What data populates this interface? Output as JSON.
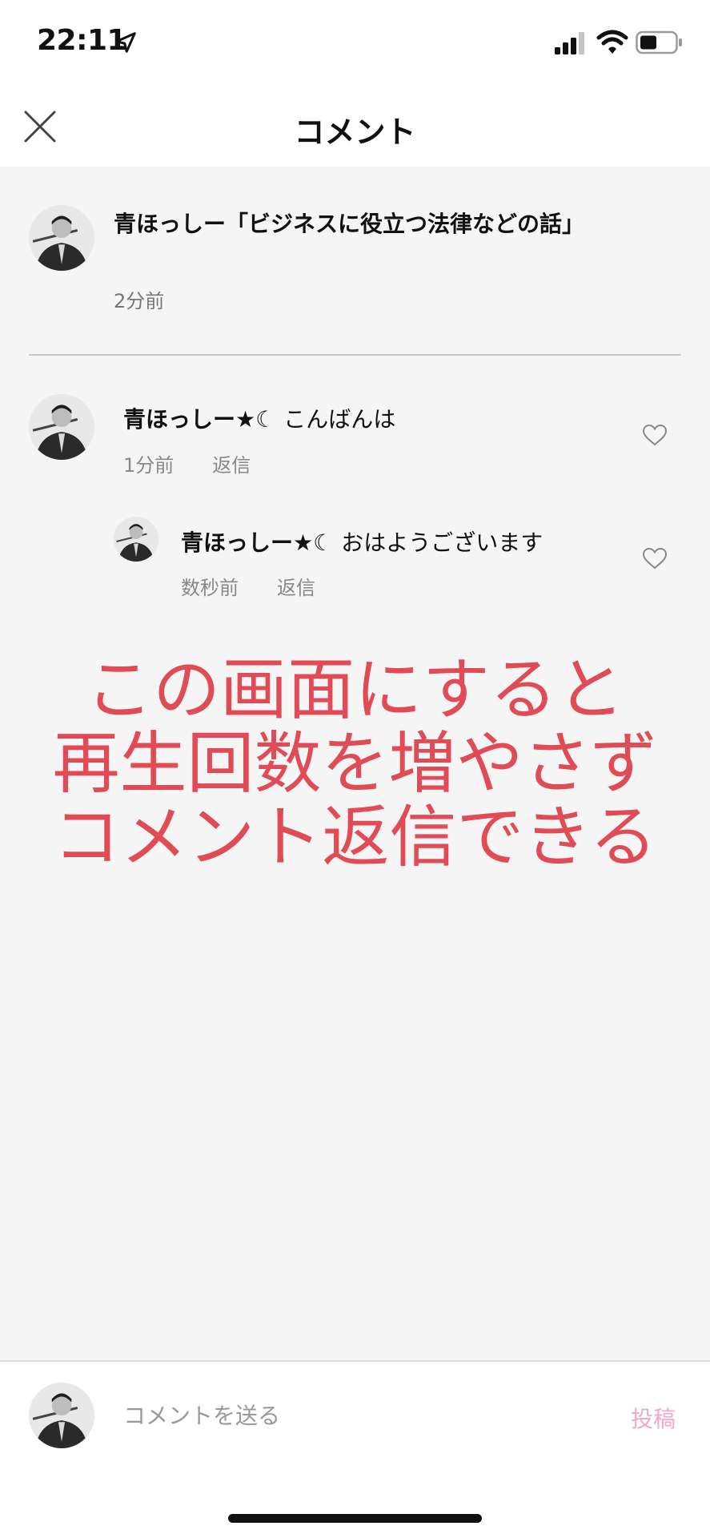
{
  "status_bar": {
    "time": "22:11",
    "icons": [
      "location-arrow-icon",
      "cellular-signal-icon",
      "wifi-icon",
      "battery-icon"
    ]
  },
  "nav": {
    "title": "コメント",
    "close_icon": "close-icon"
  },
  "post": {
    "author": "青ほっしー「ビジネスに役立つ法律などの話」",
    "time": "2分前"
  },
  "comments": [
    {
      "author": "青ほっしー★☾",
      "text": "こんばんは",
      "time": "1分前",
      "reply_label": "返信",
      "like_icon": "heart-icon"
    }
  ],
  "replies": [
    {
      "author": "青ほっしー★☾",
      "text": "おはようございます",
      "time": "数秒前",
      "reply_label": "返信",
      "like_icon": "heart-icon"
    }
  ],
  "overlay_text": {
    "line1": "この画面にすると",
    "line2": "再生回数を増やさず",
    "line3": "コメント返信できる"
  },
  "composer": {
    "placeholder": "コメントを送る",
    "value": "",
    "post_label": "投稿"
  },
  "colors": {
    "overlay": "#e04b55",
    "post_button": "#f1a9c8",
    "background": "#f5f5f5"
  }
}
